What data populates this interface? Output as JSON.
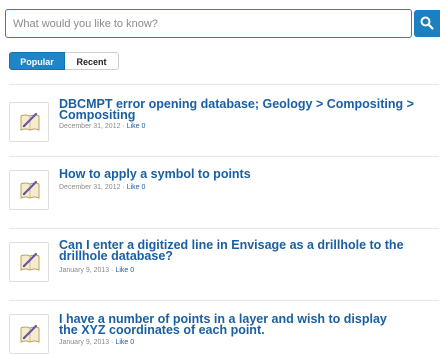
{
  "search": {
    "placeholder": "What would you like to know?",
    "button_icon": "search-icon"
  },
  "tabs": [
    {
      "label": "Popular",
      "active": true
    },
    {
      "label": "Recent",
      "active": false
    }
  ],
  "colors": {
    "accent": "#1e86c6",
    "title": "#1a5fa3",
    "meta": "#8a8a8a"
  },
  "items": [
    {
      "icon": "edit-document-icon",
      "title": "DBCMPT error opening database; Geology > Compositing > Compositing",
      "date": "December 31, 2012",
      "separator": "·",
      "like": "Like 0"
    },
    {
      "icon": "edit-document-icon",
      "title": "How to apply a symbol to points",
      "date": "December 31, 2012",
      "separator": "·",
      "like": "Like 0"
    },
    {
      "icon": "edit-document-icon",
      "title": "Can I enter a digitized line in Envisage as a drillhole to the drillhole database?",
      "date": "January 9, 2013",
      "separator": "·",
      "like": "Like 0"
    },
    {
      "icon": "edit-document-icon",
      "title": "I have a number of points in a layer and wish to display the XYZ coordinates of each point.",
      "date": "January 9, 2013",
      "separator": "·",
      "like": "Like 0"
    }
  ]
}
